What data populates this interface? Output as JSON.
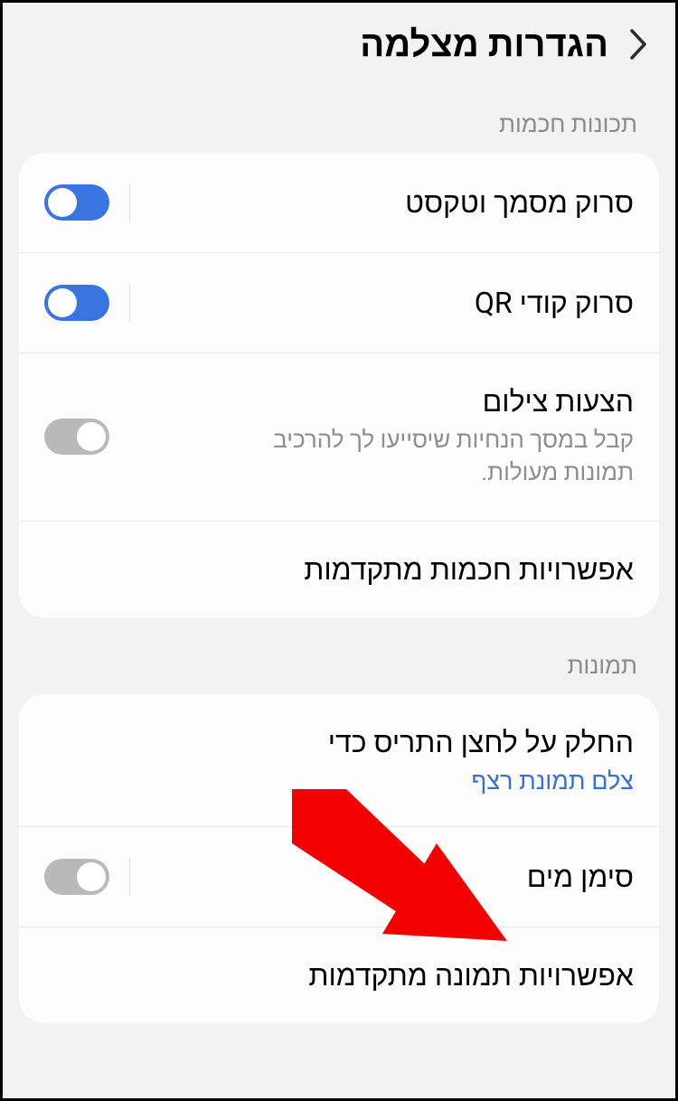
{
  "header": {
    "title": "הגדרות מצלמה"
  },
  "sections": {
    "smart": {
      "label": "תכונות חכמות",
      "scan_doc": "סרוק מסמך וטקסט",
      "scan_qr": "סרוק קודי QR",
      "suggestions_title": "הצעות צילום",
      "suggestions_sub": "קבל במסך הנחיות שיסייעו לך להרכיב תמונות מעולות.",
      "advanced": "אפשרויות חכמות מתקדמות"
    },
    "pictures": {
      "label": "תמונות",
      "swipe_title": "החלק על לחצן התריס כדי",
      "swipe_sub": "צלם תמונת רצף",
      "watermark": "סימן מים",
      "advanced": "אפשרויות תמונה מתקדמות"
    }
  },
  "toggles": {
    "scan_doc": true,
    "scan_qr": true,
    "suggestions": false,
    "watermark": false
  }
}
